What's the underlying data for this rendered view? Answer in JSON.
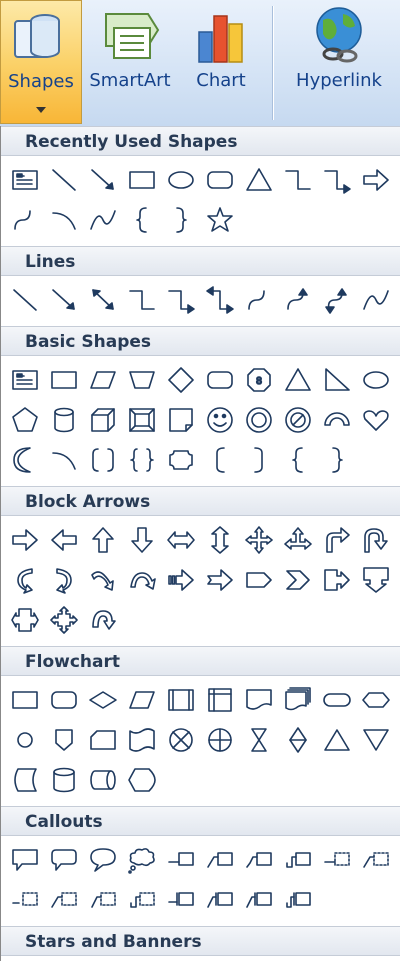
{
  "ribbon": {
    "buttons": [
      {
        "id": "shapes",
        "label": "Shapes",
        "icon": "shapes-icon",
        "active": true
      },
      {
        "id": "smartart",
        "label": "SmartArt",
        "icon": "smartart-icon"
      },
      {
        "id": "chart",
        "label": "Chart",
        "icon": "chart-icon"
      },
      {
        "id": "hyperlink",
        "label": "Hyperlink",
        "icon": "hyperlink-icon"
      }
    ]
  },
  "sections": [
    {
      "title": "Recently Used Shapes",
      "rows": [
        [
          "textbox",
          "line",
          "arrow-line",
          "rectangle",
          "oval",
          "rounded-rect",
          "triangle",
          "elbow-connector",
          "elbow-arrow",
          "right-arrow"
        ],
        [
          "curved-connector",
          "arc",
          "curve",
          "left-brace",
          "right-brace",
          "star5"
        ]
      ]
    },
    {
      "title": "Lines",
      "rows": [
        [
          "line",
          "arrow-line",
          "double-arrow-line",
          "elbow-connector",
          "elbow-arrow",
          "elbow-double-arrow",
          "curved-connector",
          "curved-arrow",
          "curved-double-arrow",
          "curve"
        ]
      ]
    },
    {
      "title": "Basic Shapes",
      "rows": [
        [
          "textbox",
          "rectangle",
          "parallelogram",
          "trapezoid",
          "diamond",
          "rounded-rect",
          "octagon",
          "triangle",
          "right-triangle",
          "oval"
        ],
        [
          "pentagon",
          "can",
          "cube",
          "bevel",
          "folded-corner",
          "smiley",
          "donut",
          "no-symbol",
          "block-arc",
          "heart"
        ],
        [
          "moon",
          "arc",
          "bracket-pair",
          "brace-pair",
          "plaque",
          "left-bracket",
          "right-bracket",
          "left-brace",
          "right-brace"
        ]
      ]
    },
    {
      "title": "Block Arrows",
      "rows": [
        [
          "right-arrow",
          "left-arrow",
          "up-arrow",
          "down-arrow",
          "left-right-arrow",
          "up-down-arrow",
          "quad-arrow",
          "left-right-up-arrow",
          "bent-arrow",
          "u-turn-arrow"
        ],
        [
          "left-curved-arrow",
          "right-curved-arrow",
          "down-curved-arrow",
          "up-curved-arrow",
          "striped-right-arrow",
          "notched-right-arrow",
          "pentagon-arrow",
          "chevron",
          "right-arrow-callout",
          "down-arrow-callout"
        ],
        [
          "left-right-arrow-callout",
          "quad-arrow-callout",
          "circular-arrow"
        ]
      ]
    },
    {
      "title": "Flowchart",
      "rows": [
        [
          "fc-process",
          "fc-alternate",
          "fc-decision",
          "fc-data",
          "fc-predefined",
          "fc-internal",
          "fc-document",
          "fc-multidoc",
          "fc-terminator",
          "fc-preparation"
        ],
        [
          "fc-connector",
          "fc-offpage",
          "fc-card",
          "fc-punched-tape",
          "fc-summing",
          "fc-or",
          "fc-collate",
          "fc-sort",
          "fc-extract",
          "fc-merge"
        ],
        [
          "fc-stored-data",
          "fc-magnetic-disk",
          "fc-direct-access",
          "fc-display"
        ]
      ]
    },
    {
      "title": "Callouts",
      "rows": [
        [
          "rect-callout",
          "rounded-callout",
          "oval-callout",
          "cloud-callout",
          "line-callout1",
          "line-callout2",
          "line-callout3",
          "line-callout4",
          "line-callout1-accent",
          "line-callout2-accent"
        ],
        [
          "line-callout3-accent",
          "line-callout4-accent",
          "line-callout1-border",
          "line-callout2-border",
          "line-callout3-border",
          "line-callout4-border",
          "line-callout-nb1",
          "line-callout-nb2"
        ]
      ]
    },
    {
      "title": "Stars and Banners",
      "rows": []
    }
  ]
}
